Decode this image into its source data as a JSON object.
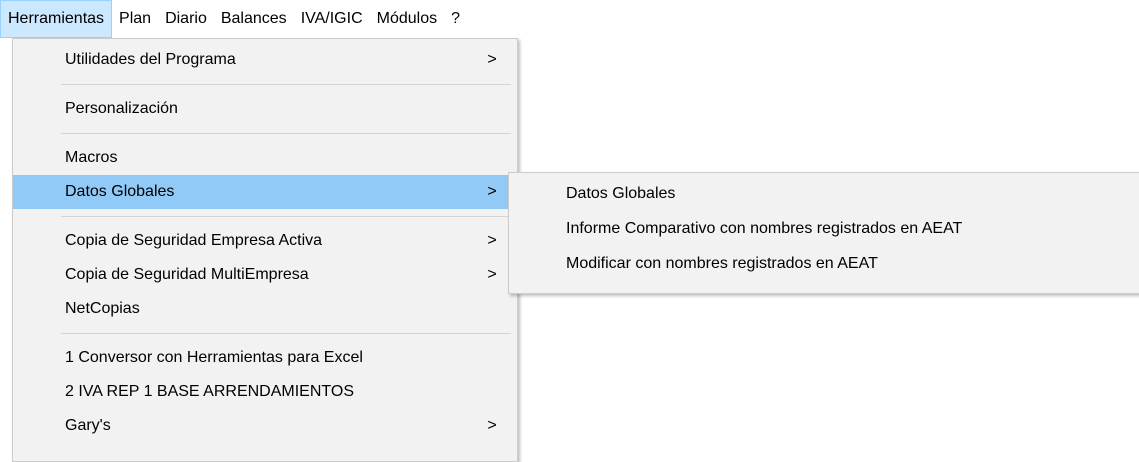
{
  "menubar": {
    "items": [
      {
        "label": "Herramientas"
      },
      {
        "label": "Plan"
      },
      {
        "label": "Diario"
      },
      {
        "label": "Balances"
      },
      {
        "label": "IVA/IGIC"
      },
      {
        "label": "Módulos"
      },
      {
        "label": "?"
      }
    ]
  },
  "menu": {
    "items": [
      {
        "label": "Utilidades del Programa",
        "arrow": ">"
      },
      {
        "label": "Personalización"
      },
      {
        "label": "Macros"
      },
      {
        "label": "Datos Globales",
        "arrow": ">"
      },
      {
        "label": "Copia de Seguridad Empresa Activa",
        "arrow": ">"
      },
      {
        "label": "Copia de Seguridad MultiEmpresa",
        "arrow": ">"
      },
      {
        "label": "NetCopias"
      },
      {
        "label": "1 Conversor con Herramientas para Excel"
      },
      {
        "label": "2 IVA REP 1 BASE ARRENDAMIENTOS"
      },
      {
        "label": "Gary's",
        "arrow": ">"
      }
    ]
  },
  "submenu": {
    "items": [
      {
        "label": "Datos Globales"
      },
      {
        "label": "Informe Comparativo con nombres registrados en AEAT"
      },
      {
        "label": "Modificar con nombres registrados en AEAT"
      }
    ]
  }
}
